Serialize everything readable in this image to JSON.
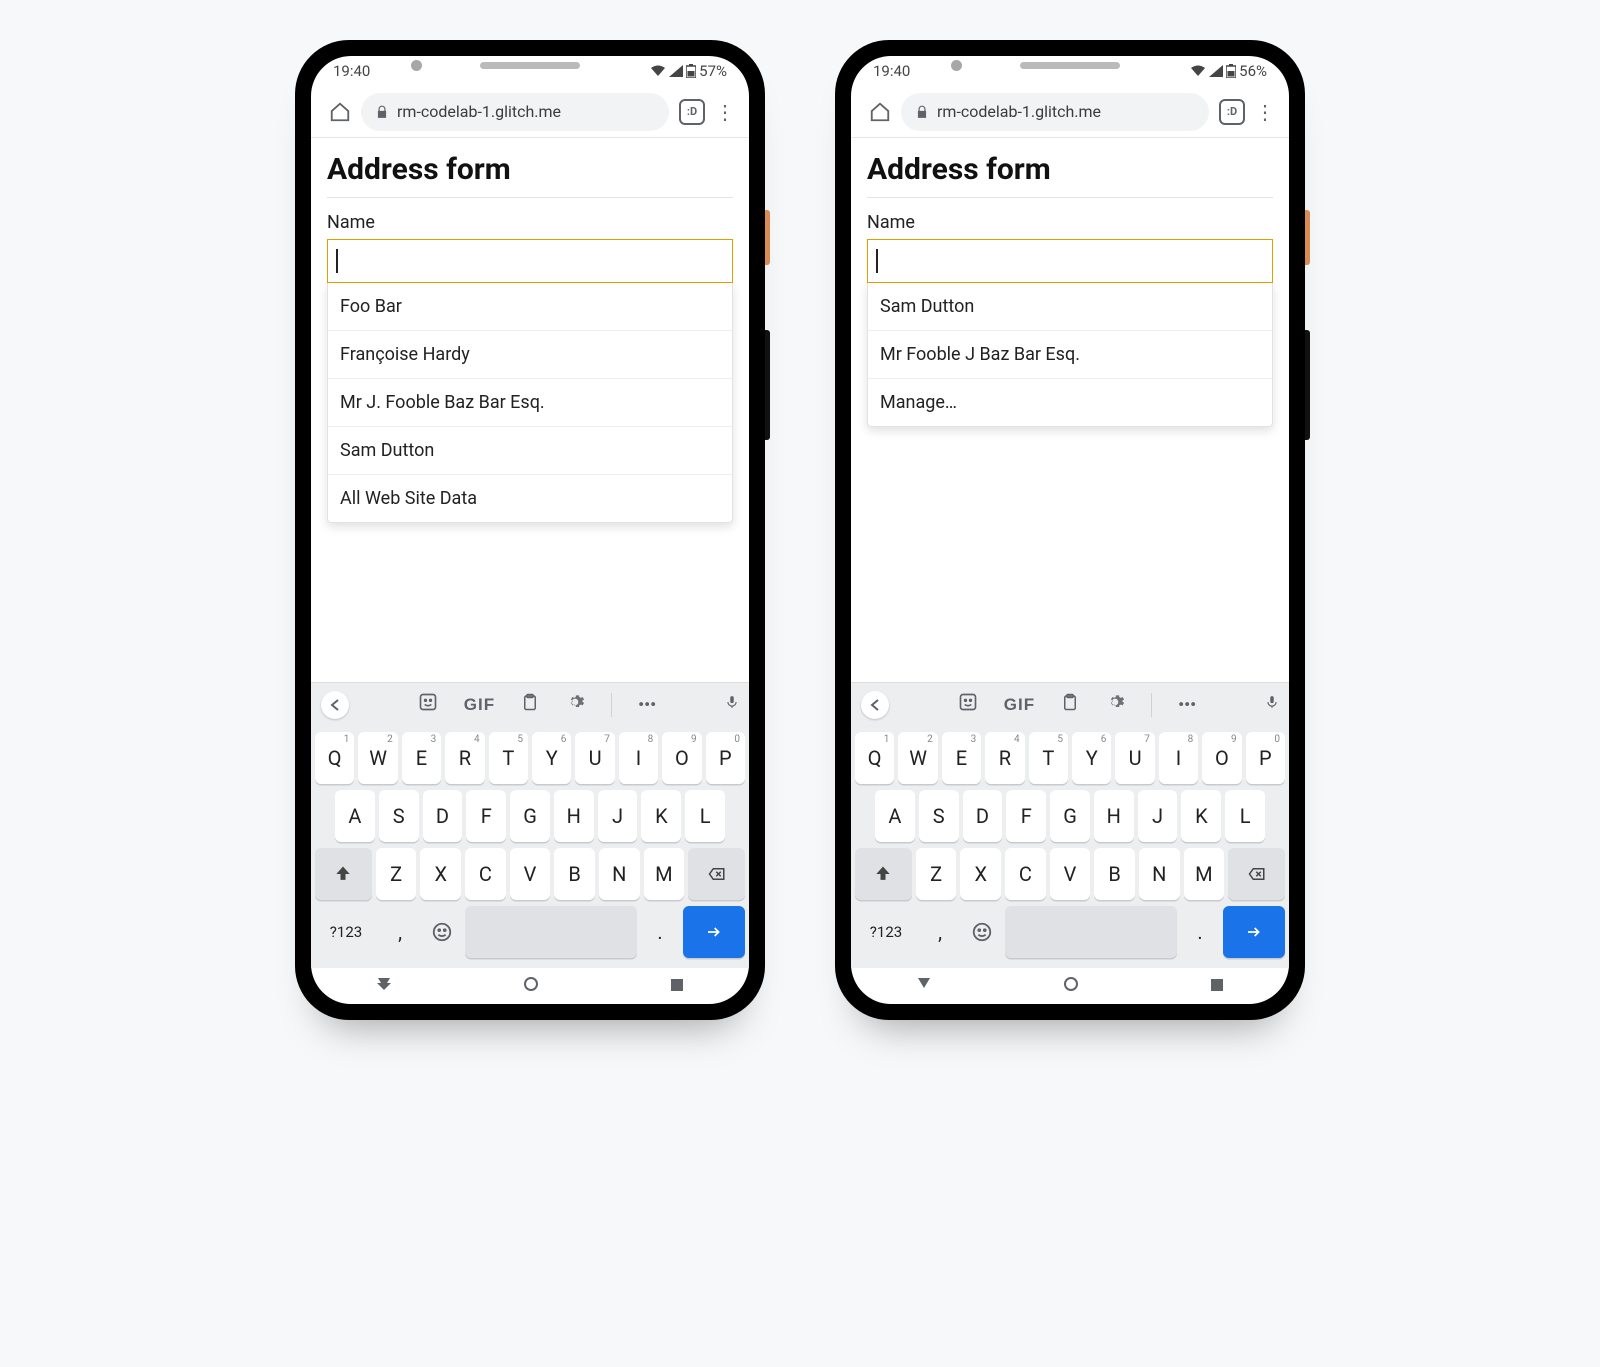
{
  "phones": [
    {
      "status": {
        "time": "19:40",
        "battery": "57%"
      },
      "toolbar": {
        "url": "rm-codelab-1.glitch.me",
        "tab": ":D"
      },
      "page": {
        "title": "Address form",
        "label": "Name",
        "suggestions": [
          "Foo Bar",
          "Françoise Hardy",
          "Mr J. Fooble Baz Bar Esq.",
          "Sam Dutton",
          "All Web Site Data"
        ]
      }
    },
    {
      "status": {
        "time": "19:40",
        "battery": "56%"
      },
      "toolbar": {
        "url": "rm-codelab-1.glitch.me",
        "tab": ":D"
      },
      "page": {
        "title": "Address form",
        "label": "Name",
        "suggestions": [
          "Sam Dutton",
          "Mr Fooble J Baz Bar Esq.",
          "Manage…"
        ]
      }
    }
  ],
  "keyboard": {
    "toolbar_items": [
      "sticker",
      "GIF",
      "clipboard",
      "settings",
      "more",
      "mic"
    ],
    "row1": [
      [
        "Q",
        "1"
      ],
      [
        "W",
        "2"
      ],
      [
        "E",
        "3"
      ],
      [
        "R",
        "4"
      ],
      [
        "T",
        "5"
      ],
      [
        "Y",
        "6"
      ],
      [
        "U",
        "7"
      ],
      [
        "I",
        "8"
      ],
      [
        "O",
        "9"
      ],
      [
        "P",
        "0"
      ]
    ],
    "row2": [
      "A",
      "S",
      "D",
      "F",
      "G",
      "H",
      "J",
      "K",
      "L"
    ],
    "row3": [
      "Z",
      "X",
      "C",
      "V",
      "B",
      "N",
      "M"
    ],
    "sym": "?123",
    "comma": ",",
    "period": "."
  }
}
